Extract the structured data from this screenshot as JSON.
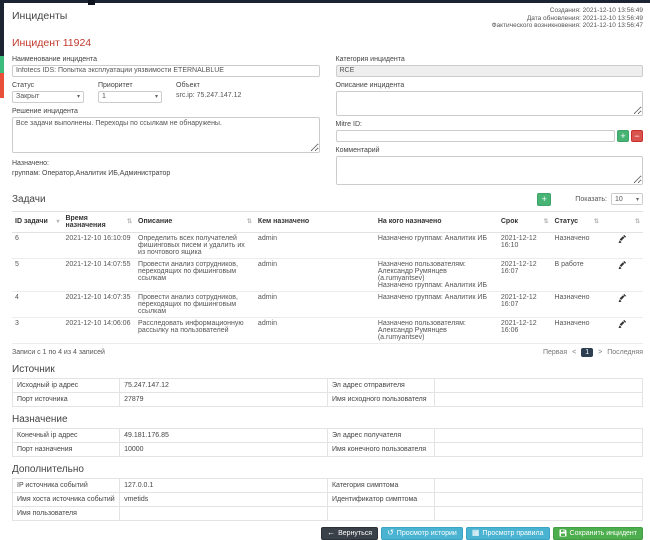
{
  "page": {
    "title": "Инциденты",
    "incident_title": "Инцидент 11924"
  },
  "meta": {
    "created": "Создания: 2021-12-10 13:56:49",
    "updated": "Дата обновления: 2021-12-10 13:56:49",
    "occurred": "Фактического возникновения: 2021-12-10 13:56:47"
  },
  "form": {
    "name_label": "Наименование инцидента",
    "name_value": "Infotecs IDS: Попытка эксплуатации уязвимости ETERNALBLUE",
    "status_label": "Статус",
    "status_value": "Закрыт",
    "priority_label": "Приоритет",
    "priority_value": "1",
    "object_label": "Объект",
    "object_value": "src.ip: 75.247.147.12",
    "resolution_label": "Решение инцидента",
    "resolution_value": "Все задачи выполнены. Переходы по ссылкам не обнаружены.",
    "assigned_label": "Назначено:",
    "assigned_groups": "группам: Оператор,Аналитик ИБ,Администратор",
    "category_label": "Категория инцидента",
    "category_value": "RCE",
    "description_label": "Описание инцидента",
    "description_value": "",
    "mitre_label": "Mitre ID:",
    "mitre_value": "",
    "comment_label": "Комментарий",
    "comment_value": ""
  },
  "icons": {
    "sort": "⇅",
    "sort_active": "▾",
    "caret": "▾",
    "plus": "+",
    "minus": "−",
    "back": "←",
    "history": "↺",
    "rule": "▦"
  },
  "tasks": {
    "title": "Задачи",
    "show_label": "Показать:",
    "show_value": "10",
    "headers": [
      "ID задачи",
      "Время назначения",
      "Описание",
      "Кем назначено",
      "На кого назначено",
      "Срок",
      "Статус"
    ],
    "rows": [
      {
        "id": "6",
        "time": "2021-12-10 16:10:09",
        "desc": "Определить всех получателей фишинговых писем и удалить их из почтового ящика",
        "by": "admin",
        "to": "Назначено группам: Аналитик ИБ",
        "due": "2021-12-12 16:10",
        "status": "Назначено"
      },
      {
        "id": "5",
        "time": "2021-12-10 14:07:55",
        "desc": "Провести анализ сотрудников, переходящих по фишинговым ссылкам",
        "by": "admin",
        "to": "Назначено пользователям: Александр Румянцев (a.rumyantsev)\nНазначено группам: Аналитик ИБ",
        "due": "2021-12-12 16:07",
        "status": "В работе"
      },
      {
        "id": "4",
        "time": "2021-12-10 14:07:35",
        "desc": "Провести анализ сотрудников, переходящих по фишинговым ссылкам",
        "by": "admin",
        "to": "Назначено группам: Аналитик ИБ",
        "due": "2021-12-12 16:07",
        "status": "Назначено"
      },
      {
        "id": "3",
        "time": "2021-12-10 14:06:06",
        "desc": "Расследовать информационную рассылку на пользователей",
        "by": "admin",
        "to": "Назначено пользователям: Александр Румянцев (a.rumyantsev)",
        "due": "2021-12-12 16:06",
        "status": "Назначено"
      }
    ],
    "records_info": "Записи с 1 по 4 из 4 записей",
    "pagination": {
      "first": "Первая",
      "prev": "<",
      "page": "1",
      "next": ">",
      "last": "Последняя"
    }
  },
  "source": {
    "title": "Источник",
    "rows": [
      {
        "l1": "Исходный ip адрес",
        "v1": "75.247.147.12",
        "l2": "Эл адрес отправителя",
        "v2": ""
      },
      {
        "l1": "Порт источника",
        "v1": "27879",
        "l2": "Имя исходного пользователя",
        "v2": ""
      }
    ]
  },
  "destination": {
    "title": "Назначение",
    "rows": [
      {
        "l1": "Конечный ip адрес",
        "v1": "49.181.176.85",
        "l2": "Эл адрес получателя",
        "v2": ""
      },
      {
        "l1": "Порт назначения",
        "v1": "10000",
        "l2": "Имя конечного пользователя",
        "v2": ""
      }
    ]
  },
  "additional": {
    "title": "Дополнительно",
    "rows": [
      {
        "l1": "IP источника событий",
        "v1": "127.0.0.1",
        "l2": "Категория симптома",
        "v2": ""
      },
      {
        "l1": "Имя хоста источника событий",
        "v1": "vmetids",
        "l2": "Идентификатор симптома",
        "v2": ""
      },
      {
        "l1": "Имя пользователя",
        "v1": "",
        "l2": "",
        "v2": ""
      }
    ]
  },
  "footer": {
    "back": "Вернуться",
    "history": "Просмотр истории",
    "rule": "Просмотр правила",
    "save": "Сохранить инцидент"
  },
  "colors": {
    "title_red": "#c0392b",
    "link_blue": "#8094c8",
    "accent_green": "#47b475",
    "accent_red": "#d9534f",
    "btn_dark": "#3a4149",
    "btn_info": "#49b3d1",
    "btn_success": "#4cae4c",
    "pagination_active": "#2c3e50",
    "topbar": "#1c2434"
  }
}
